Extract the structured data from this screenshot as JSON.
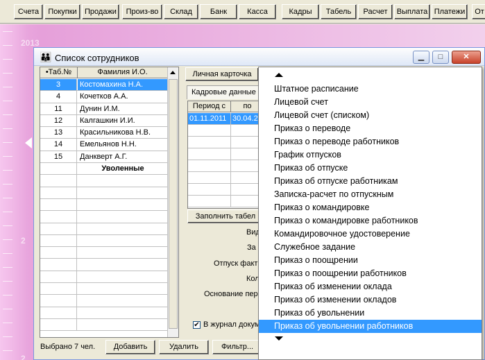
{
  "toolbar": {
    "buttons": [
      "Счета",
      "Покупки",
      "Продажи",
      "Произ-во",
      "Склад",
      "Банк",
      "Касса",
      "Кадры",
      "Табель",
      "Расчет",
      "Выплата",
      "Платежи",
      "От"
    ]
  },
  "desktop": {
    "year_label": "2013",
    "year_label_short": "2"
  },
  "window": {
    "title": "Список сотрудников",
    "buttons": {
      "minimize": "▁",
      "maximize": "□",
      "close": "✕"
    }
  },
  "employees": {
    "headers": {
      "tab_no": "•Таб.№",
      "name": "Фамилия И.О."
    },
    "rows": [
      {
        "tab_no": "3",
        "name": "Костомахина Н.А.",
        "selected": true
      },
      {
        "tab_no": "4",
        "name": "Кочетков А.А."
      },
      {
        "tab_no": "11",
        "name": "Дунин И.М."
      },
      {
        "tab_no": "12",
        "name": "Калгашкин И.И."
      },
      {
        "tab_no": "13",
        "name": "Красильникова Н.В."
      },
      {
        "tab_no": "14",
        "name": "Емельянов Н.Н."
      },
      {
        "tab_no": "15",
        "name": "Данкверт А.Г."
      },
      {
        "tab_no": "",
        "name": "Уволенные",
        "group": true
      }
    ],
    "status": "Выбрано 7 чел."
  },
  "panel": {
    "personal_card_button": "Личная карточка",
    "hr_tab": "Кадровые данные",
    "period_headers": {
      "from": "Период с",
      "to": "по"
    },
    "period_rows": [
      {
        "from": "01.11.2011",
        "to": "30.04.20"
      }
    ],
    "fill_button": "Заполнить табел",
    "field_labels": [
      "Вид",
      "За",
      "Отпуск факт",
      "Кол",
      "Основание пер"
    ],
    "journal_checkbox": "В журнал докум",
    "journal_checked": true
  },
  "bottom_buttons": {
    "add": "Добавить",
    "delete": "Удалить",
    "filter": "Фильтр..."
  },
  "menu": {
    "items": [
      "Штатное расписание",
      "Лицевой счет",
      "Лицевой счет (списком)",
      "Приказ о переводе",
      "Приказ о переводе работников",
      "График отпусков",
      "Приказ об отпуске",
      "Приказ об отпуске работникам",
      "Записка-расчет по отпускным",
      "Приказ о командировке",
      "Приказ о командировке работников",
      "Командировочное удостоверение",
      "Служебное задание",
      "Приказ о поощрении",
      "Приказ о поощрении работников",
      "Приказ об изменении оклада",
      "Приказ об изменении окладов",
      "Приказ об увольнении",
      "Приказ об увольнении работников"
    ],
    "selected_index": 18
  },
  "colors": {
    "selection": "#3399ff",
    "desktop": "#e8a5dd"
  }
}
